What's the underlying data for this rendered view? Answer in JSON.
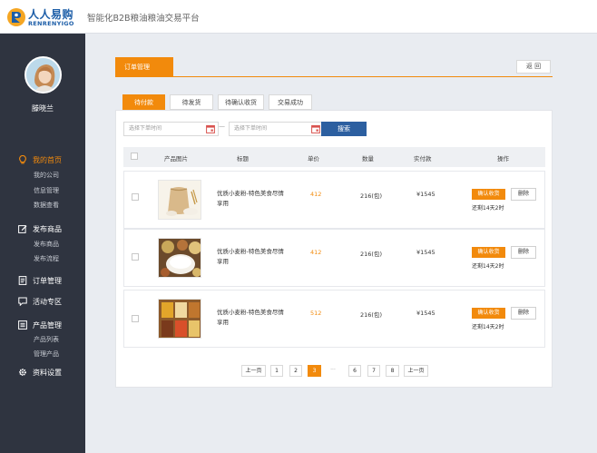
{
  "header": {
    "logo_cn": "人人易购",
    "logo_en": "RENRENYIGO",
    "site_title": "智能化B2B粮油粮油交易平台"
  },
  "sidebar": {
    "user_name": "滕晓兰",
    "groups": [
      {
        "label": "我的首页",
        "icon": "lightbulb-icon",
        "active": true,
        "items": [
          "我的公司",
          "信息管理",
          "数据查看"
        ]
      },
      {
        "label": "发布商品",
        "icon": "edit-icon",
        "active": false,
        "items": [
          "发布商品",
          "发布流程"
        ]
      },
      {
        "label": "订单管理",
        "icon": "document-icon",
        "active": false,
        "items": []
      },
      {
        "label": "活动专区",
        "icon": "chat-icon",
        "active": false,
        "items": []
      },
      {
        "label": "产品管理",
        "icon": "list-icon",
        "active": false,
        "items": [
          "产品列表",
          "管理产品"
        ]
      },
      {
        "label": "资料设置",
        "icon": "gear-icon",
        "active": false,
        "items": []
      }
    ]
  },
  "panel": {
    "tab_label": "订单管理",
    "back_label": "返 回"
  },
  "status_tabs": [
    "待付款",
    "待发货",
    "待确认收货",
    "交易成功"
  ],
  "filters": {
    "start_placeholder": "选择下单时间",
    "end_placeholder": "选择下单时间",
    "separator": "—",
    "search_label": "搜索"
  },
  "table": {
    "headers": [
      "产品图片",
      "标题",
      "单价",
      "数量",
      "实付款",
      "操作"
    ],
    "rows": [
      {
        "title": "优质小麦粉-特色美食尽情享用",
        "price": "412",
        "qty": "216(包)",
        "paid": "¥1545",
        "confirm": "确认收货",
        "delete": "删除",
        "remain": "还剩14天2时",
        "image": "flour-sack"
      },
      {
        "title": "优质小麦粉-特色美食尽情享用",
        "price": "412",
        "qty": "216(包)",
        "paid": "¥1545",
        "confirm": "确认收货",
        "delete": "删除",
        "remain": "还剩14天2时",
        "image": "rice-grains"
      },
      {
        "title": "优质小麦粉-特色美食尽情享用",
        "price": "512",
        "qty": "216(包)",
        "paid": "¥1545",
        "confirm": "确认收货",
        "delete": "删除",
        "remain": "还剩14天2时",
        "image": "mixed-grains"
      }
    ]
  },
  "pagination": {
    "prev": "上一页",
    "next": "上一页",
    "pages": [
      "1",
      "2",
      "3",
      "···",
      "6",
      "7",
      "8"
    ],
    "current": "3"
  },
  "colors": {
    "accent": "#f28a0c",
    "sidebar": "#2f3440",
    "primary_button": "#2c5fa0"
  }
}
